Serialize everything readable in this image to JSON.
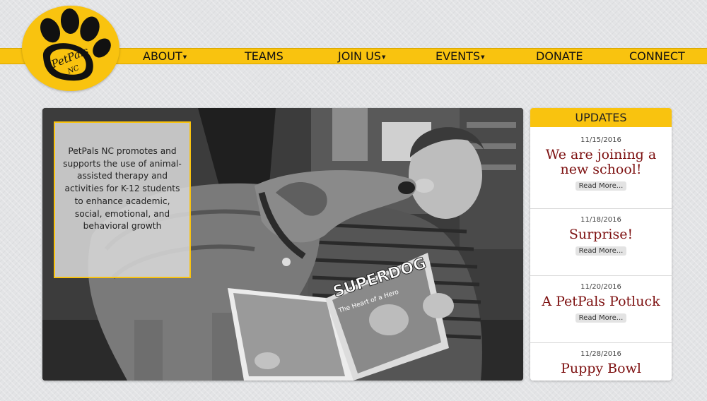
{
  "logo": {
    "text_main": "PetPals",
    "text_sub": "NC"
  },
  "nav": {
    "items": [
      {
        "label": "ABOUT",
        "dropdown": true
      },
      {
        "label": "TEAMS",
        "dropdown": false
      },
      {
        "label": "JOIN US",
        "dropdown": true
      },
      {
        "label": "EVENTS",
        "dropdown": true
      },
      {
        "label": "DONATE",
        "dropdown": false
      },
      {
        "label": "CONNECT",
        "dropdown": false
      }
    ],
    "caret": "▼"
  },
  "hero": {
    "mission": "PetPals NC promotes and supports the use of animal-assisted therapy and activities for K-12 students to enhance academic, social, emotional, and behavioral growth",
    "book_title": "SUPERDOG",
    "book_subtitle": "The Heart of a Hero"
  },
  "updates": {
    "header": "UPDATES",
    "items": [
      {
        "date": "11/15/2016",
        "title": "We are joining a new school!",
        "button": "Read More..."
      },
      {
        "date": "11/18/2016",
        "title": "Surprise!",
        "button": "Read More..."
      },
      {
        "date": "11/20/2016",
        "title": "A PetPals Potluck",
        "button": "Read More..."
      },
      {
        "date": "11/28/2016",
        "title": "Puppy Bowl",
        "button": ""
      }
    ]
  },
  "colors": {
    "brand_yellow": "#f9c30f",
    "title_maroon": "#7d1010"
  }
}
